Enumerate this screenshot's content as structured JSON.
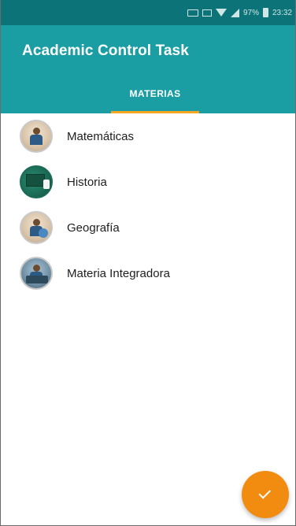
{
  "status_bar": {
    "battery_text": "97%",
    "time": "23:32"
  },
  "app_bar": {
    "title": "Academic Control Task",
    "tabs": [
      {
        "label": "MATERIAS",
        "selected": true
      }
    ]
  },
  "subjects": [
    {
      "name": "Matemáticas",
      "icon": "student-with-books-avatar"
    },
    {
      "name": "Historia",
      "icon": "chalkboard-avatar"
    },
    {
      "name": "Geografía",
      "icon": "student-with-books-avatar"
    },
    {
      "name": "Materia Integradora",
      "icon": "students-at-desk-avatar"
    }
  ],
  "fab": {
    "icon": "check-icon"
  },
  "colors": {
    "status_bar": "#0c7478",
    "app_bar": "#1a9ea3",
    "tab_indicator": "#f5a623",
    "fab": "#f28c10"
  }
}
